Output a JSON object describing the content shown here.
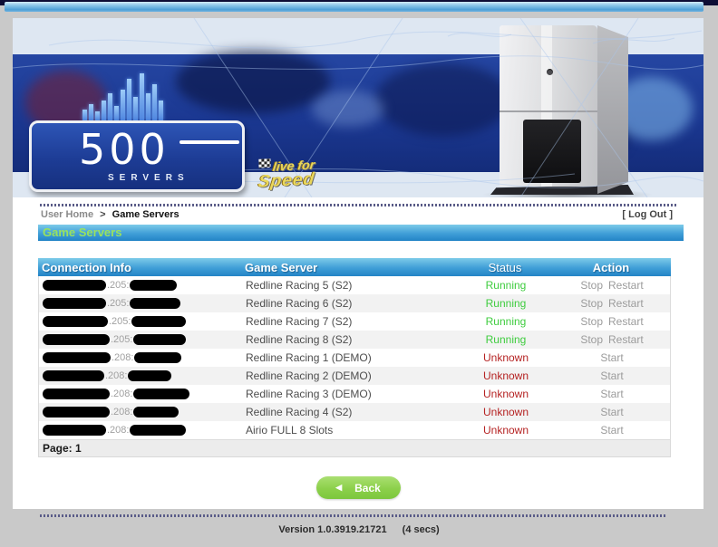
{
  "nav": {
    "breadcrumb_parent": "User Home",
    "breadcrumb_sep": ">",
    "breadcrumb_current": "Game Servers",
    "logout": "[ Log Out ]"
  },
  "banner": {
    "logo_number": "500",
    "logo_word": "SERVERS",
    "lfs_line1": "live for",
    "lfs_line2": "Speed"
  },
  "section_title": "Game Servers",
  "table": {
    "headers": {
      "connection": "Connection Info",
      "server": "Game Server",
      "status": "Status",
      "action": "Action"
    },
    "rows": [
      {
        "conn": ".205:",
        "server": "Redline Racing 5 (S2)",
        "status": "Running",
        "status_color": "#3ecc3e",
        "actions": [
          "Stop",
          "Restart"
        ],
        "redact": [
          70,
          52
        ]
      },
      {
        "conn": ".205:",
        "server": "Redline Racing 6 (S2)",
        "status": "Running",
        "status_color": "#3ecc3e",
        "actions": [
          "Stop",
          "Restart"
        ],
        "redact": [
          70,
          56
        ]
      },
      {
        "conn": ".205:",
        "server": "Redline Racing 7 (S2)",
        "status": "Running",
        "status_color": "#3ecc3e",
        "actions": [
          "Stop",
          "Restart"
        ],
        "redact": [
          72,
          60
        ]
      },
      {
        "conn": ".205:",
        "server": "Redline Racing 8 (S2)",
        "status": "Running",
        "status_color": "#3ecc3e",
        "actions": [
          "Stop",
          "Restart"
        ],
        "redact": [
          74,
          58
        ]
      },
      {
        "conn": ".208:",
        "server": "Redline Racing 1 (DEMO)",
        "status": "Unknown",
        "status_color": "#b52222",
        "actions": [
          "Start"
        ],
        "redact": [
          75,
          52
        ]
      },
      {
        "conn": ".208:",
        "server": "Redline Racing 2 (DEMO)",
        "status": "Unknown",
        "status_color": "#b52222",
        "actions": [
          "Start"
        ],
        "redact": [
          68,
          48
        ]
      },
      {
        "conn": ".208:",
        "server": "Redline Racing 3 (DEMO)",
        "status": "Unknown",
        "status_color": "#b52222",
        "actions": [
          "Start"
        ],
        "redact": [
          74,
          62
        ]
      },
      {
        "conn": ".208:",
        "server": "Redline Racing 4 (S2)",
        "status": "Unknown",
        "status_color": "#b52222",
        "actions": [
          "Start"
        ],
        "redact": [
          74,
          50
        ]
      },
      {
        "conn": ".208:",
        "server": "Airio FULL 8 Slots",
        "status": "Unknown",
        "status_color": "#b52222",
        "actions": [
          "Start"
        ],
        "redact": [
          70,
          62
        ]
      }
    ],
    "page_label": "Page: 1"
  },
  "back_button": {
    "arrow": "◀",
    "label": "Back"
  },
  "footer": {
    "version": "Version 1.0.3919.21721",
    "elapsed": "(4 secs)"
  },
  "colors": {
    "status_running": "#3ecc3e",
    "status_unknown": "#b52222",
    "accent_green": "#9ae25e",
    "bar_blue_top": "#7dcbe9",
    "bar_blue_bottom": "#2384c6",
    "back_green": "#8cd04a",
    "page_bg": "#c9c9c9"
  }
}
